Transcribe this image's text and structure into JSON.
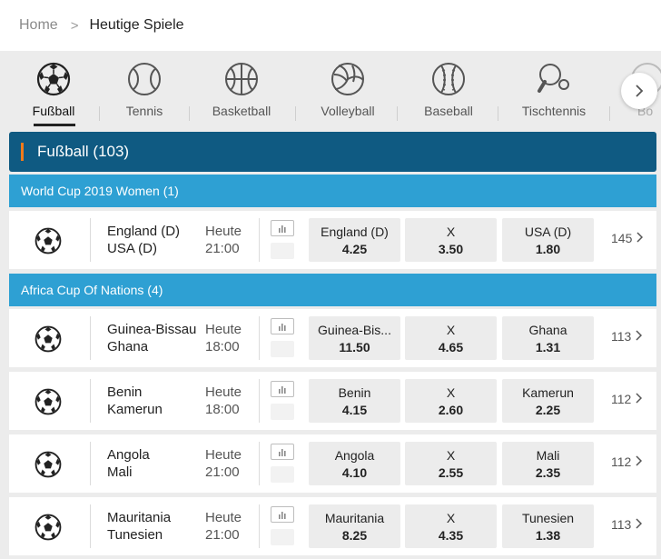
{
  "breadcrumb": {
    "home": "Home",
    "separator": ">",
    "current": "Heutige Spiele"
  },
  "sports": [
    {
      "label": "Fußball",
      "icon": "soccer-ball-icon",
      "active": true
    },
    {
      "label": "Tennis",
      "icon": "tennis-ball-icon"
    },
    {
      "label": "Basketball",
      "icon": "basketball-icon"
    },
    {
      "label": "Volleyball",
      "icon": "volleyball-icon"
    },
    {
      "label": "Baseball",
      "icon": "baseball-icon"
    },
    {
      "label": "Tischtennis",
      "icon": "table-tennis-icon"
    },
    {
      "label": "Bo",
      "icon": "bowling-icon"
    }
  ],
  "section": {
    "title": "Fußball (103)"
  },
  "leagues": [
    {
      "name": "World Cup 2019 Women",
      "count": "(1)"
    },
    {
      "name": "Africa Cup Of Nations",
      "count": "(4)"
    }
  ],
  "matches": [
    {
      "home": "England (D)",
      "away": "USA (D)",
      "day": "Heute",
      "time": "21:00",
      "odds": [
        {
          "label": "England (D)",
          "value": "4.25"
        },
        {
          "label": "X",
          "value": "3.50"
        },
        {
          "label": "USA (D)",
          "value": "1.80"
        }
      ],
      "more": "145"
    },
    {
      "home": "Guinea-Bissau",
      "away": "Ghana",
      "day": "Heute",
      "time": "18:00",
      "odds": [
        {
          "label": "Guinea-Bis...",
          "value": "11.50"
        },
        {
          "label": "X",
          "value": "4.65"
        },
        {
          "label": "Ghana",
          "value": "1.31"
        }
      ],
      "more": "113"
    },
    {
      "home": "Benin",
      "away": "Kamerun",
      "day": "Heute",
      "time": "18:00",
      "odds": [
        {
          "label": "Benin",
          "value": "4.15"
        },
        {
          "label": "X",
          "value": "2.60"
        },
        {
          "label": "Kamerun",
          "value": "2.25"
        }
      ],
      "more": "112"
    },
    {
      "home": "Angola",
      "away": "Mali",
      "day": "Heute",
      "time": "21:00",
      "odds": [
        {
          "label": "Angola",
          "value": "4.10"
        },
        {
          "label": "X",
          "value": "2.55"
        },
        {
          "label": "Mali",
          "value": "2.35"
        }
      ],
      "more": "112"
    },
    {
      "home": "Mauritania",
      "away": "Tunesien",
      "day": "Heute",
      "time": "21:00",
      "odds": [
        {
          "label": "Mauritania",
          "value": "8.25"
        },
        {
          "label": "X",
          "value": "4.35"
        },
        {
          "label": "Tunesien",
          "value": "1.38"
        }
      ],
      "more": "113"
    }
  ],
  "colors": {
    "section_bg": "#0f5a82",
    "league_bg": "#2ea0d3",
    "accent": "#f07a1a"
  }
}
